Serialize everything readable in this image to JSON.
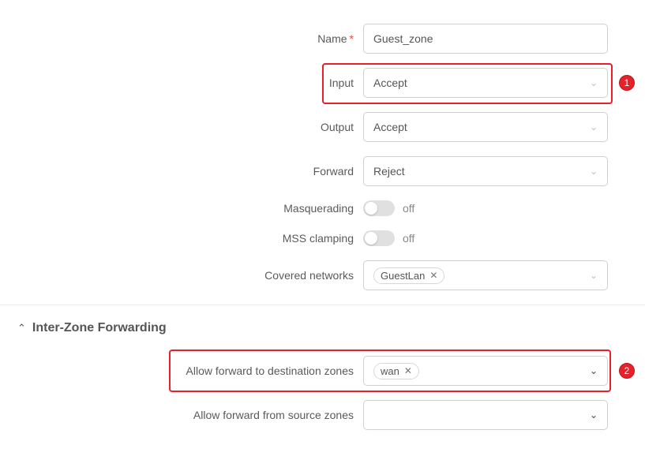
{
  "fields": {
    "name": {
      "label": "Name",
      "value": "Guest_zone",
      "required": true
    },
    "input": {
      "label": "Input",
      "value": "Accept"
    },
    "output": {
      "label": "Output",
      "value": "Accept"
    },
    "forward": {
      "label": "Forward",
      "value": "Reject"
    },
    "masquerading": {
      "label": "Masquerading",
      "state": "off"
    },
    "mss_clamping": {
      "label": "MSS clamping",
      "state": "off"
    },
    "covered_networks": {
      "label": "Covered networks",
      "tags": [
        "GuestLan"
      ]
    }
  },
  "section": {
    "title": "Inter-Zone Forwarding"
  },
  "forwarding": {
    "dest": {
      "label": "Allow forward to destination zones",
      "tags": [
        "wan"
      ]
    },
    "src": {
      "label": "Allow forward from source zones",
      "tags": []
    }
  },
  "callouts": {
    "one": "1",
    "two": "2"
  }
}
